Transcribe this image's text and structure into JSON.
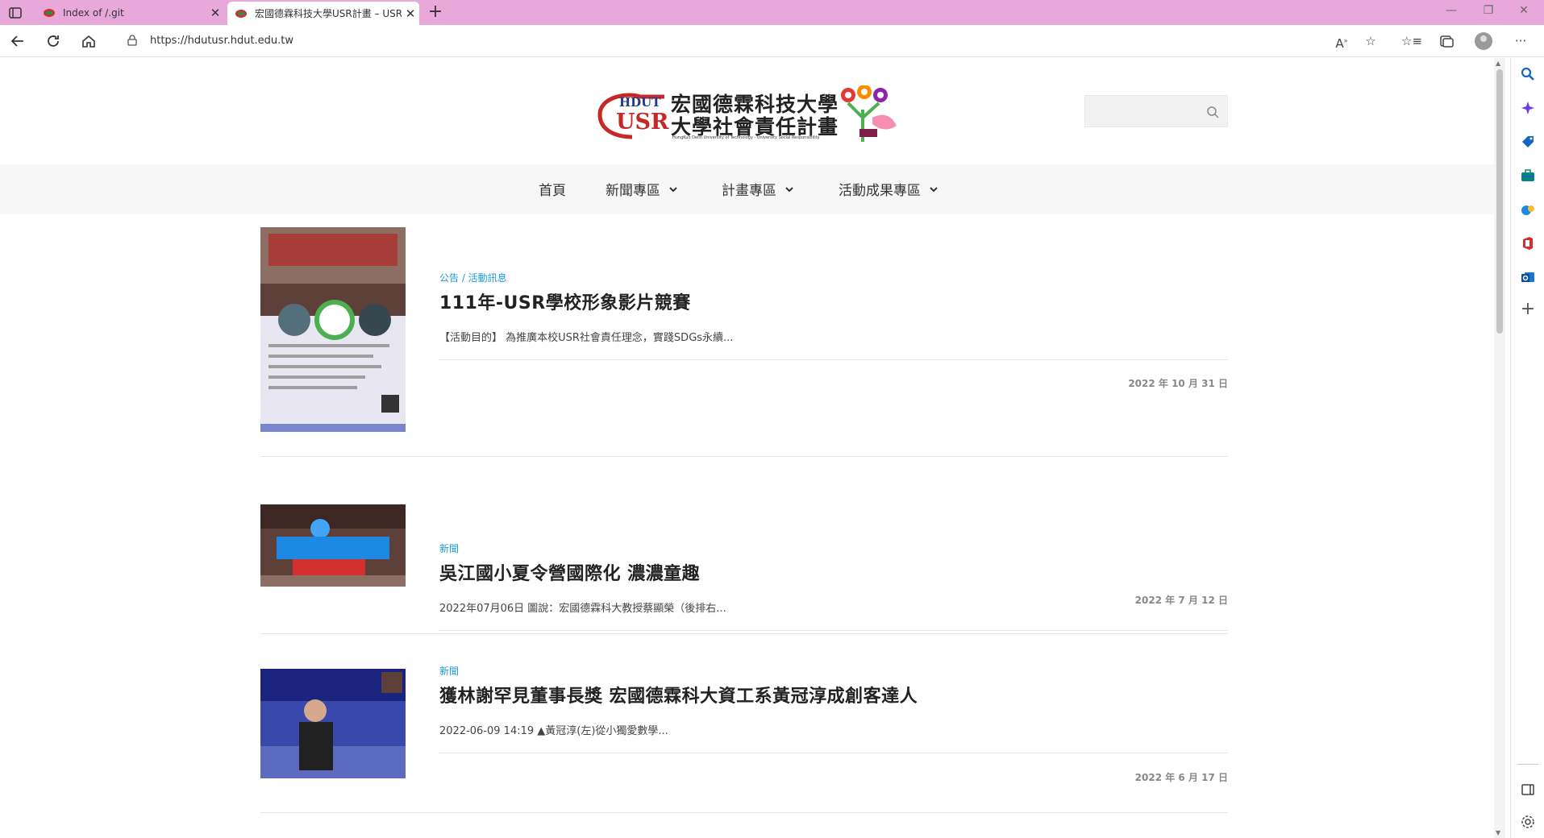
{
  "browser": {
    "tabs": [
      {
        "title": "Index of /.git"
      },
      {
        "title": "宏國德霖科技大學USR計畫 – USR"
      }
    ],
    "url": "https://hdutusr.hdut.edu.tw"
  },
  "site": {
    "logo": {
      "line1": "宏國德霖科技大學",
      "line2": "大學社會責任計畫",
      "subtitle": "HungKuo Delin University of Technology - University Social Responsibility",
      "badge_top": "HDUT",
      "badge_bottom": "USR"
    },
    "search": {
      "placeholder": ""
    },
    "nav": [
      {
        "label": "首頁"
      },
      {
        "label": "新聞專區"
      },
      {
        "label": "計畫專區"
      },
      {
        "label": "活動成果專區"
      }
    ]
  },
  "posts": [
    {
      "category": "公告 / 活動訊息",
      "title": "111年-USR學校形象影片競賽",
      "excerpt": "【活動目的】 為推廣本校USR社會責任理念，實踐SDGs永續...",
      "date": "2022 年 10 月 31 日"
    },
    {
      "category": "新聞",
      "title": "吳江國小夏令營國際化 濃濃童趣",
      "excerpt": "2022年07月06日 圖說：宏國德霖科大教授蔡顯榮（後排右...",
      "date": "2022 年 7 月 12 日"
    },
    {
      "category": "新聞",
      "title": "獲林謝罕見董事長獎 宏國德霖科大資工系黃冠淳成創客達人",
      "excerpt": "2022-06-09 14:19 ▲黃冠淳(左)從小獨愛數學...",
      "date": "2022 年 6 月 17 日"
    }
  ],
  "colors": {
    "tabbar": "#e8a8d9",
    "accent_link": "#1a9cd8",
    "nav_bg": "#f7f7f7"
  }
}
